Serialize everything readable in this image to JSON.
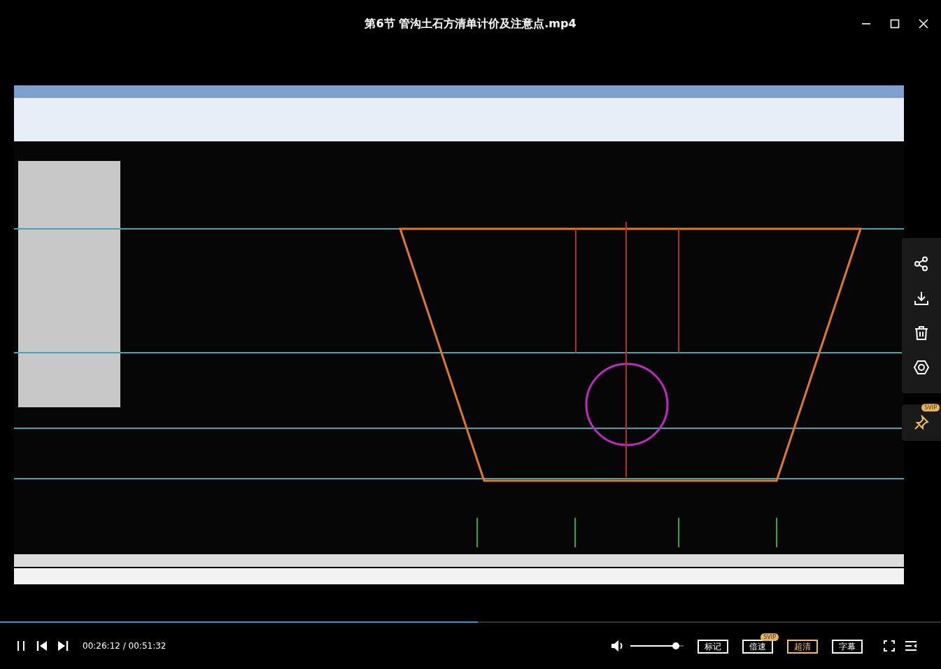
{
  "window": {
    "title": "第6节 管沟土石方清单计价及注意点.mp4"
  },
  "side_panel": {
    "pin_badge": "SVIP"
  },
  "progress": {
    "level": 0.508
  },
  "time": "00:26:12 / 00:51:32",
  "volume": {
    "level": 0.85
  },
  "buttons": [
    {
      "label": "标记",
      "highlighted": false
    },
    {
      "label": "倍速",
      "badge": "SVIP",
      "highlighted": false
    },
    {
      "label": "超清",
      "highlighted": true
    },
    {
      "label": "字幕",
      "highlighted": false
    }
  ]
}
